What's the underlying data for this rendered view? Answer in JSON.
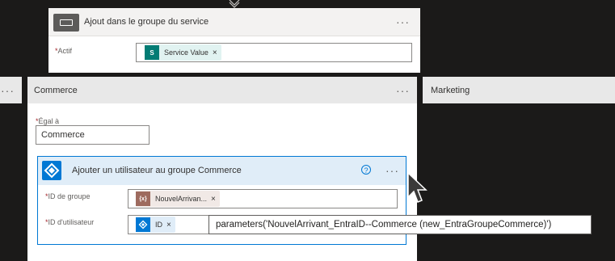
{
  "top_card": {
    "title": "Ajout dans le groupe du service",
    "menu": "···",
    "field_label": "Actif",
    "required_mark": "*",
    "token": {
      "icon": "sharepoint-icon",
      "icon_text": "S",
      "label": "Service Value",
      "remove": "×",
      "color": "#e1f3f1"
    }
  },
  "branches": {
    "left_menu": "···",
    "commerce": {
      "title": "Commerce",
      "menu": "···",
      "equals_label": "Égal à",
      "equals_value": "Commerce"
    },
    "marketing": {
      "title": "Marketing"
    }
  },
  "action_card": {
    "title": "Ajouter un utilisateur au groupe Commerce",
    "help": "?",
    "menu": "···",
    "fields": [
      {
        "label": "ID de groupe",
        "token_label": "NouvelArrivan...",
        "token_icon": "variable-icon",
        "token_icon_text": "{x}",
        "remove": "×"
      },
      {
        "label": "ID d'utilisateur",
        "token_label": "ID",
        "token_icon": "entra-id-icon",
        "remove": "×"
      }
    ]
  },
  "tooltip": {
    "text": "parameters('NouvelArrivant_EntraID--Commerce (new_EntraGroupeCommerce)')"
  },
  "colors": {
    "background": "#1b1a19",
    "accent": "#0078d4",
    "required": "#a4262c"
  }
}
